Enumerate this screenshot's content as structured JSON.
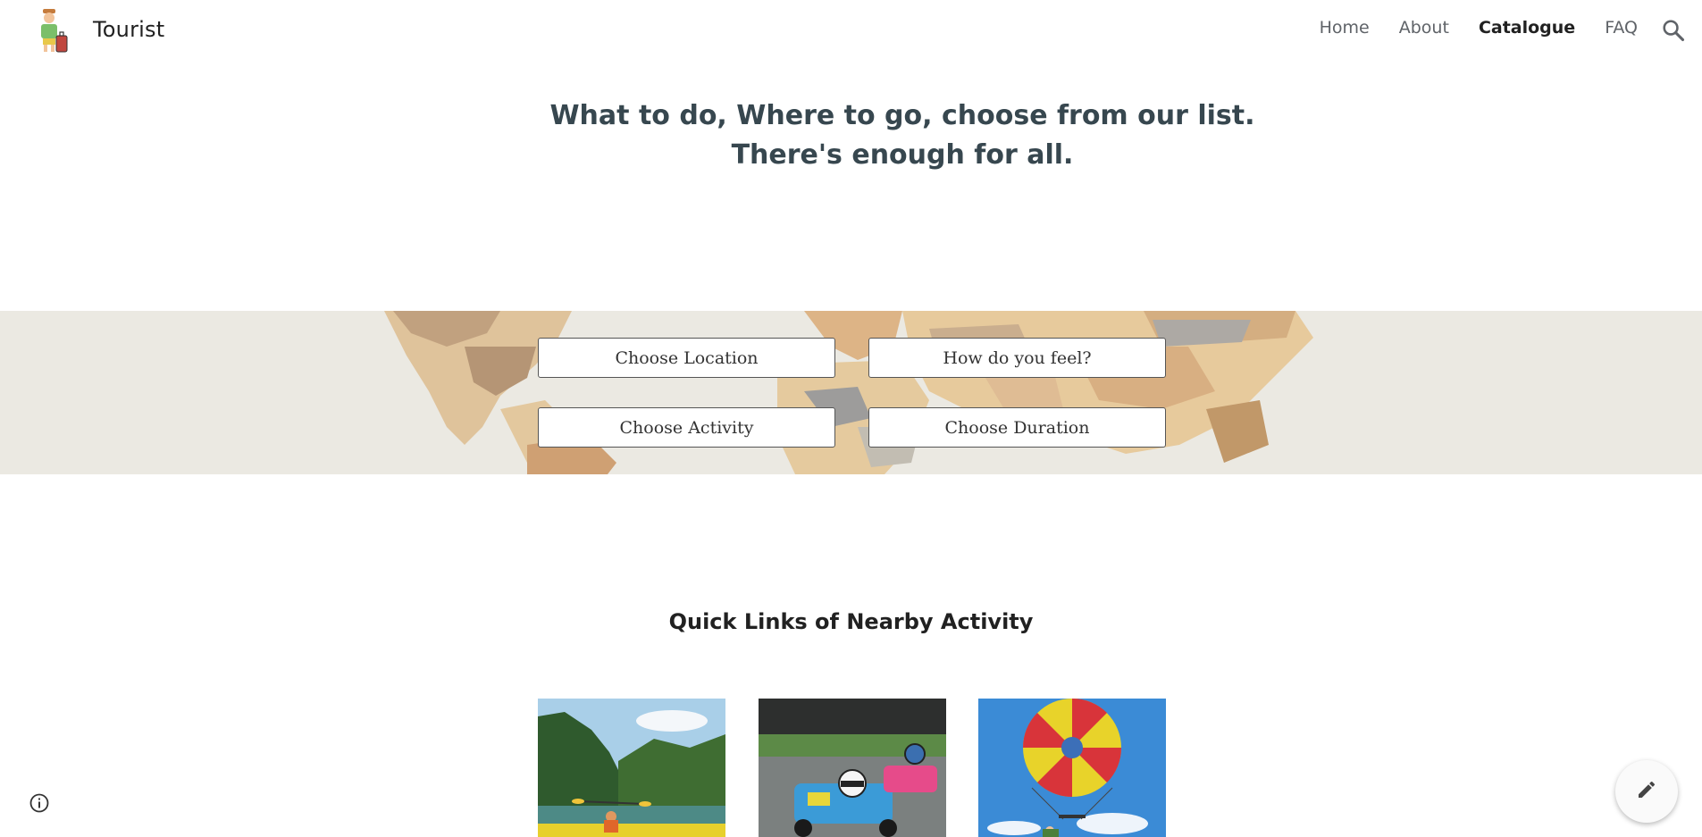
{
  "header": {
    "site_title": "Tourist",
    "logo_icon": "tourist-with-luggage-icon",
    "nav": [
      {
        "label": "Home",
        "active": false
      },
      {
        "label": "About",
        "active": false
      },
      {
        "label": "Catalogue",
        "active": true
      },
      {
        "label": "FAQ",
        "active": false
      }
    ],
    "search_icon": "search-icon"
  },
  "hero": {
    "heading": "What to do, Where to go, choose from our list. There's enough for all."
  },
  "banner": {
    "background": "world-map-image",
    "buttons": {
      "location": "Choose Location",
      "feel": "How do you feel?",
      "activity": "Choose Activity",
      "duration": "Choose Duration"
    }
  },
  "quick_links": {
    "title": "Quick Links of Nearby Activity",
    "items": [
      {
        "image": "kayaking-photo"
      },
      {
        "image": "go-karting-photo"
      },
      {
        "image": "parasailing-photo"
      }
    ]
  },
  "floating": {
    "info_icon": "info-icon",
    "edit_icon": "pencil-icon"
  },
  "colors": {
    "heading": "#37474f",
    "nav_inactive": "#5f6368",
    "nav_active": "#212121",
    "banner_bg": "#eae7e1"
  }
}
